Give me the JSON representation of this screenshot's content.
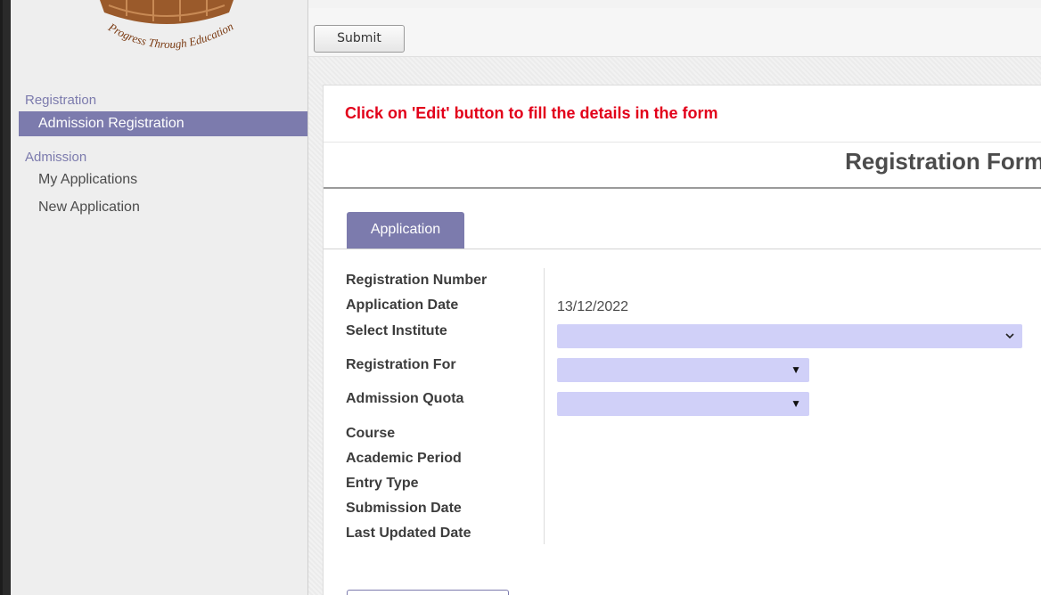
{
  "logo": {
    "tagline": "Progress Through Education"
  },
  "sidebar": {
    "sections": [
      {
        "header": "Registration",
        "items": [
          {
            "label": "Admission Registration",
            "active": true
          }
        ]
      },
      {
        "header": "Admission",
        "items": [
          {
            "label": "My Applications",
            "active": false
          },
          {
            "label": "New Application",
            "active": false
          }
        ]
      }
    ]
  },
  "toolbar": {
    "submit_label": "Submit"
  },
  "form": {
    "notice": "Click on 'Edit' button to fill the details in the form",
    "title": "Registration Form",
    "tab_label": "Application",
    "fields": {
      "registration_number": {
        "label": "Registration Number",
        "value": ""
      },
      "application_date": {
        "label": "Application Date",
        "value": "13/12/2022"
      },
      "select_institute": {
        "label": "Select Institute",
        "value": ""
      },
      "registration_for": {
        "label": "Registration For",
        "value": ""
      },
      "admission_quota": {
        "label": "Admission Quota",
        "value": ""
      },
      "course": {
        "label": "Course",
        "value": ""
      },
      "academic_period": {
        "label": "Academic Period",
        "value": ""
      },
      "entry_type": {
        "label": "Entry Type",
        "value": ""
      },
      "submission_date": {
        "label": "Submission Date",
        "value": ""
      },
      "last_updated_date": {
        "label": "Last Updated Date",
        "value": ""
      }
    }
  },
  "icons": {
    "select_chevron": "chevron-down-icon",
    "select_caret": "caret-down-icon"
  },
  "colors": {
    "accent": "#7c7bad",
    "notice": "#e2001a",
    "select_bg": "#d0d0f8"
  }
}
